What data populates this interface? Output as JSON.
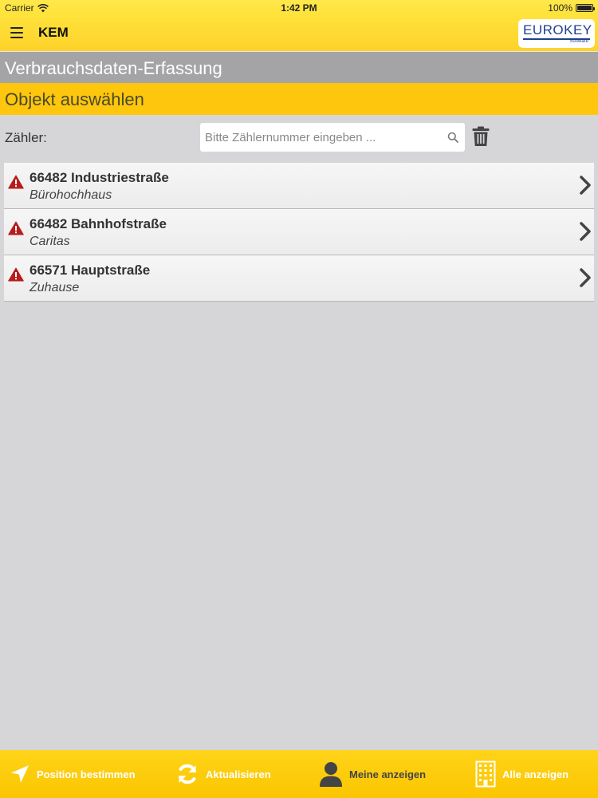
{
  "status_bar": {
    "carrier": "Carrier",
    "time": "1:42 PM",
    "battery": "100%"
  },
  "header": {
    "title": "KEM",
    "logo_text": "EUROKEY",
    "logo_sub": "Software"
  },
  "sections": {
    "capture_title": "Verbrauchsdaten-Erfassung",
    "select_title": "Objekt auswählen"
  },
  "search": {
    "label": "Zähler:",
    "placeholder": "Bitte Zählernummer eingeben ...",
    "value": ""
  },
  "objects": [
    {
      "title": "66482 Industriestraße",
      "subtitle": "Bürohochhaus",
      "status_icon": "warning-icon"
    },
    {
      "title": "66482 Bahnhofstraße",
      "subtitle": "Caritas",
      "status_icon": "warning-icon"
    },
    {
      "title": "66571 Hauptstraße",
      "subtitle": "Zuhause",
      "status_icon": "warning-icon"
    }
  ],
  "toolbar": {
    "position_label": "Position bestimmen",
    "refresh_label": "Aktualisieren",
    "mine_label": "Meine anzeigen",
    "all_label": "Alle anzeigen"
  },
  "colors": {
    "accent_yellow": "#fec60c",
    "header_yellow": "#ffe23a",
    "section_gray": "#a4a4a6",
    "warning_red": "#b81c1c",
    "logo_blue": "#1f3f8f"
  }
}
